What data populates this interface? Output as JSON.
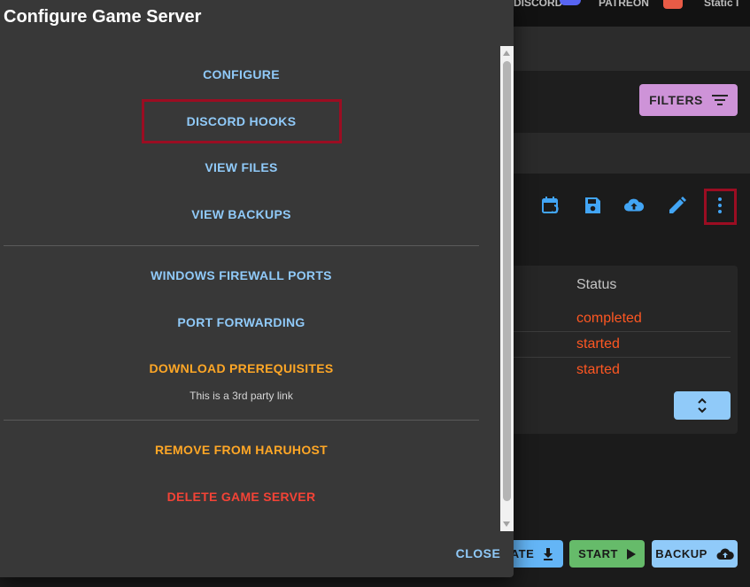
{
  "topbar": {
    "left_text": "DISCORD",
    "mid_text": "PATREON",
    "right_text": "Static I"
  },
  "filters_button": {
    "label": "FILTERS"
  },
  "toolbar_icons": [
    "calendar-refresh-icon",
    "save-icon",
    "cloud-upload-icon",
    "pencil-icon",
    "more-vertical-icon"
  ],
  "table": {
    "status_header": "Status",
    "rows": [
      "completed",
      "started",
      "started"
    ]
  },
  "bottom_buttons": {
    "update": "ATE",
    "start": "START",
    "backup": "BACKUP"
  },
  "dialog": {
    "title": "Configure Game Server",
    "actions": {
      "configure": "CONFIGURE",
      "discord_hooks": "DISCORD HOOKS",
      "view_files": "VIEW FILES",
      "view_backups": "VIEW BACKUPS",
      "windows_firewall_ports": "WINDOWS FIREWALL PORTS",
      "port_forwarding": "PORT FORWARDING",
      "download_prerequisites": "DOWNLOAD PREREQUISITES",
      "third_party_note": "This is a 3rd party link",
      "remove_from_haruhost": "REMOVE FROM HARUHOST",
      "delete_game_server": "DELETE GAME SERVER"
    },
    "close_label": "CLOSE"
  },
  "colors": {
    "dialog_bg": "#383838",
    "link_blue": "#90caf9",
    "link_orange": "#ffa726",
    "link_red": "#f44336",
    "highlight": "#9b0d22",
    "status_orange": "#ff5722",
    "filters_purple": "#ce93d8",
    "start_green": "#66bb6a"
  }
}
